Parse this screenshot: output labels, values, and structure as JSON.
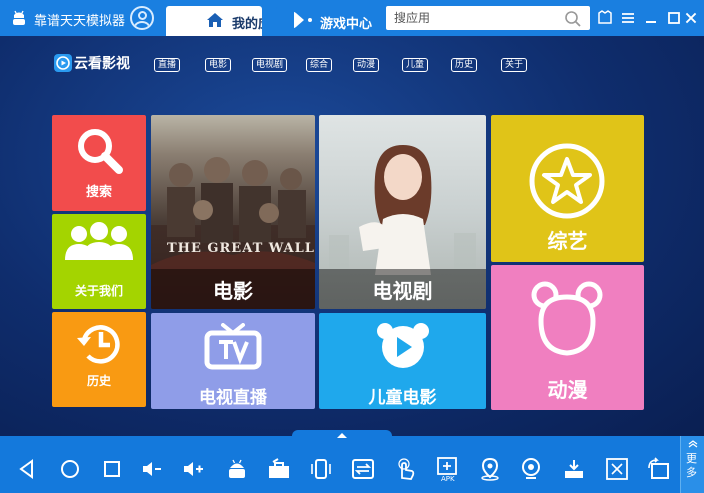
{
  "titlebar": {
    "app_name": "靠谱天天模拟器",
    "tabs": [
      {
        "label": "我的应用",
        "icon": "home-icon"
      },
      {
        "label": "游戏中心",
        "icon": "gamepad-icon"
      }
    ],
    "search_placeholder": "搜应用",
    "window_buttons": [
      "skin-icon",
      "menu-icon",
      "minimize-icon",
      "maximize-icon",
      "close-icon"
    ]
  },
  "app": {
    "brand": "云看影视",
    "nav": [
      "直播",
      "电影",
      "电视剧",
      "综合",
      "动漫",
      "儿童",
      "历史",
      "关于"
    ]
  },
  "tiles": {
    "search": {
      "label": "搜索",
      "icon": "magnifier-icon",
      "color": "#f24c4c"
    },
    "about": {
      "label": "关于我们",
      "icon": "people-icon",
      "color": "#a4d400"
    },
    "history": {
      "label": "历史",
      "icon": "history-icon",
      "color": "#f99a12"
    },
    "movie": {
      "label": "电影",
      "poster_text": "THE GREAT WALL"
    },
    "tvseries": {
      "label": "电视剧"
    },
    "variety": {
      "label": "综艺",
      "icon": "star-icon",
      "color": "#e0c418"
    },
    "live": {
      "label": "电视直播",
      "icon": "tv-icon",
      "color": "#8f9de8"
    },
    "kids": {
      "label": "儿童电影",
      "icon": "play-icon",
      "color": "#1fa8ec"
    },
    "anime": {
      "label": "动漫",
      "icon": "bear-icon",
      "color": "#f07fc0"
    }
  },
  "taskbar": {
    "icons": [
      "back-icon",
      "home-circle-icon",
      "recent-apps-icon",
      "volume-down-icon",
      "volume-up-icon",
      "android-icon",
      "toolbox-icon",
      "shake-icon",
      "sync-icon",
      "touch-icon",
      "apk-install-icon",
      "location-icon",
      "camera-icon",
      "download-icon",
      "screenshot-icon",
      "rotate-icon"
    ],
    "apk_label": "APK",
    "more_label": "更多"
  }
}
